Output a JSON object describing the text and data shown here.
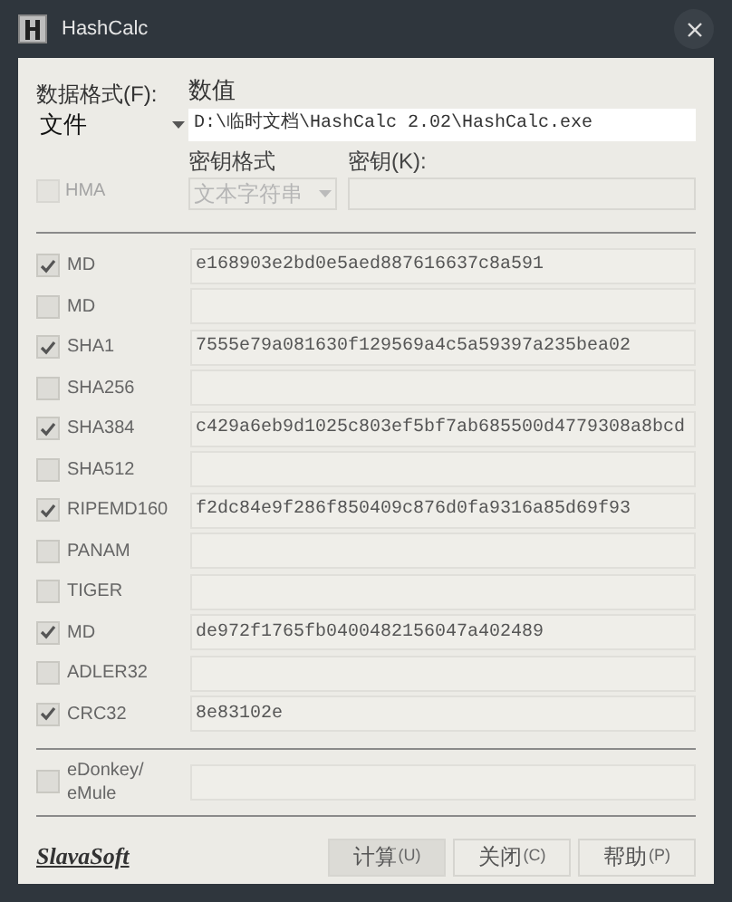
{
  "window": {
    "title": "HashCalc"
  },
  "data_format": {
    "label": "数据格式(F):",
    "value": "文件"
  },
  "value_field": {
    "label": "数值",
    "value": "D:\\临时文档\\HashCalc 2.02\\HashCalc.exe"
  },
  "hmac": {
    "label": "HMA",
    "checked": false,
    "disabled": true
  },
  "key_format": {
    "label": "密钥格式",
    "value": "文本字符串",
    "disabled": true
  },
  "key": {
    "label": "密钥(K):",
    "disabled": true
  },
  "hashes": [
    {
      "label": "MD",
      "checked": true,
      "value": "e168903e2bd0e5aed887616637c8a591"
    },
    {
      "label": "MD",
      "checked": false
    },
    {
      "label": "SHA1",
      "checked": true,
      "value": "7555e79a081630f129569a4c5a59397a235bea02"
    },
    {
      "label": "SHA256",
      "checked": false
    },
    {
      "label": "SHA384",
      "checked": true,
      "value": "c429a6eb9d1025c803ef5bf7ab685500d4779308a8bcd"
    },
    {
      "label": "SHA512",
      "checked": false
    },
    {
      "label": "RIPEMD160",
      "checked": true,
      "value": "f2dc84e9f286f850409c876d0fa9316a85d69f93"
    },
    {
      "label": "PANAM",
      "checked": false
    },
    {
      "label": "TIGER",
      "checked": false
    },
    {
      "label": "MD",
      "checked": true,
      "value": "de972f1765fb0400482156047a402489"
    },
    {
      "label": "ADLER32",
      "checked": false
    },
    {
      "label": "CRC32",
      "checked": true,
      "value": "8e83102e"
    }
  ],
  "edonkey": {
    "label_lines": [
      "eDonkey/",
      "eMule"
    ],
    "checked": false
  },
  "brand": "SlavaSoft",
  "buttons": [
    {
      "label": "计算",
      "shortcut": "(U)",
      "selected": true
    },
    {
      "label": "关闭",
      "shortcut": "(C)",
      "selected": false
    },
    {
      "label": "帮助",
      "shortcut": "(P)",
      "selected": false
    }
  ]
}
